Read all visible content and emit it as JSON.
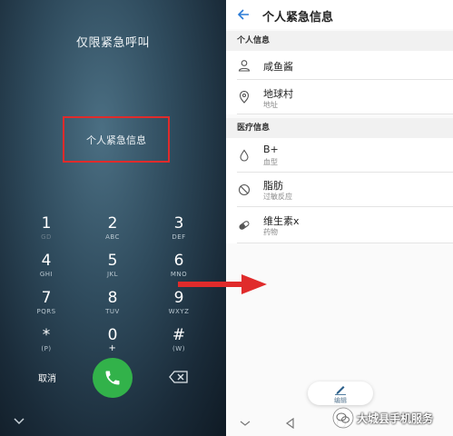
{
  "dialer": {
    "title": "仅限紧急呼叫",
    "emergency_info_label": "个人紧急信息",
    "keys": [
      {
        "num": "1",
        "sub": "GD"
      },
      {
        "num": "2",
        "sub": "ABC"
      },
      {
        "num": "3",
        "sub": "DEF"
      },
      {
        "num": "4",
        "sub": "GHI"
      },
      {
        "num": "5",
        "sub": "JKL"
      },
      {
        "num": "6",
        "sub": "MNO"
      },
      {
        "num": "7",
        "sub": "PQRS"
      },
      {
        "num": "8",
        "sub": "TUV"
      },
      {
        "num": "9",
        "sub": "WXYZ"
      },
      {
        "num": "*",
        "sub": "(P)"
      },
      {
        "num": "0",
        "sub": "+"
      },
      {
        "num": "#",
        "sub": "(W)"
      }
    ],
    "cancel_label": "取消"
  },
  "info_page": {
    "title": "个人紧急信息",
    "sections": [
      {
        "header": "个人信息",
        "rows": [
          {
            "icon": "person-icon",
            "main": "咸鱼酱",
            "sub": ""
          },
          {
            "icon": "location-pin-icon",
            "main": "地球村",
            "sub": "地址"
          }
        ]
      },
      {
        "header": "医疗信息",
        "rows": [
          {
            "icon": "blood-drop-icon",
            "main": "B+",
            "sub": "血型"
          },
          {
            "icon": "prohibited-icon",
            "main": "脂肪",
            "sub": "过敏反应"
          },
          {
            "icon": "pill-icon",
            "main": "维生素x",
            "sub": "药物"
          }
        ]
      }
    ],
    "edit_label": "编辑"
  },
  "watermark": {
    "text": "大城县手机服务"
  },
  "colors": {
    "highlight_box": "#e02b2b",
    "call_button": "#32b24a",
    "arrow": "#e02b2b"
  }
}
